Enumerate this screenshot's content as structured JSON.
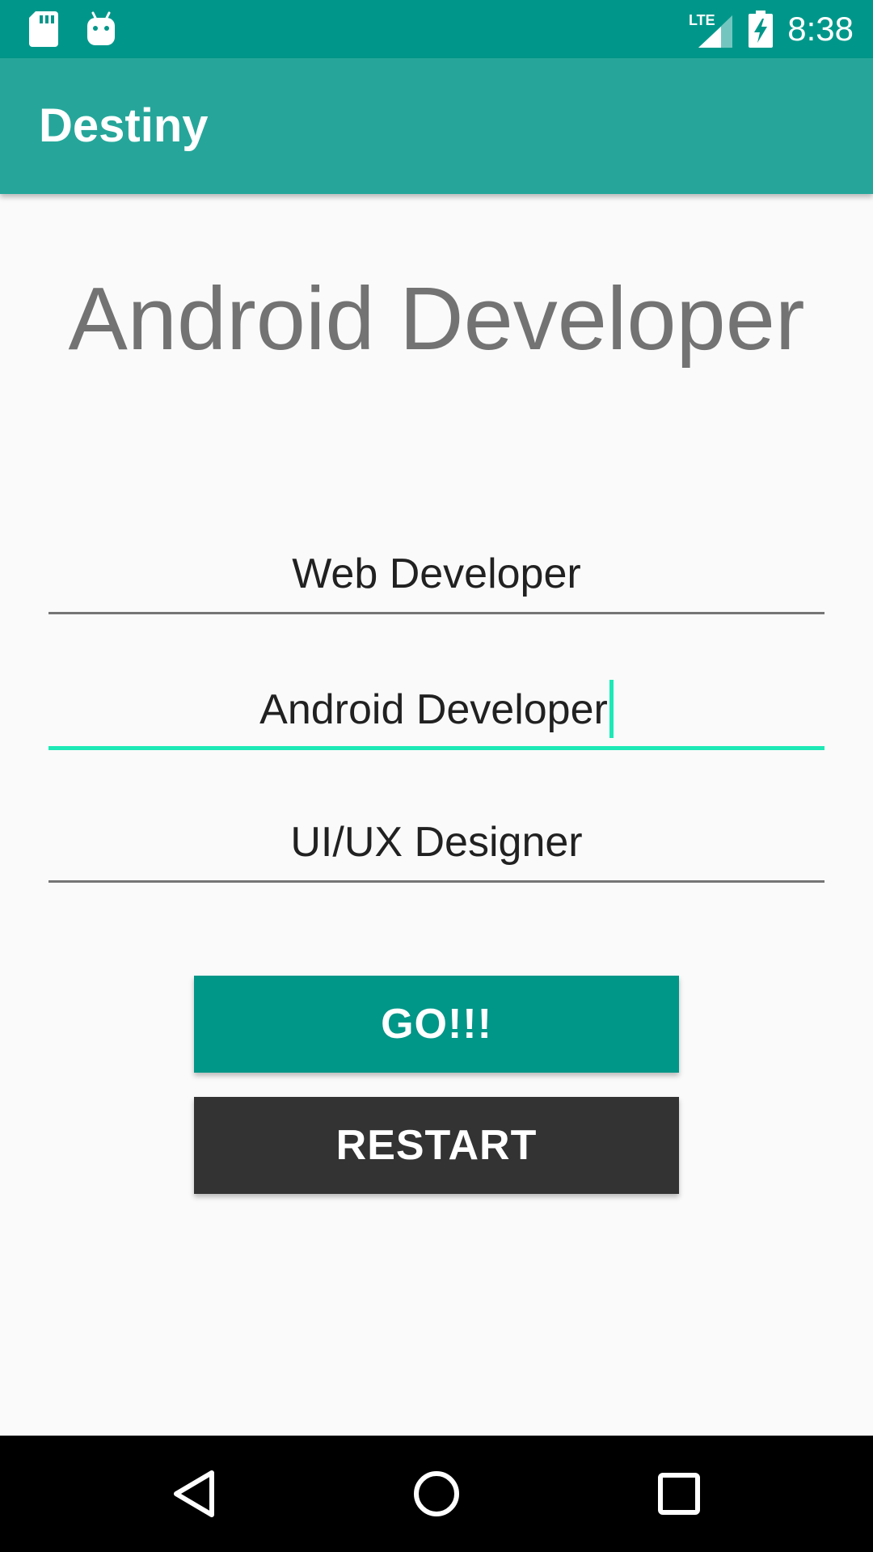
{
  "status_bar": {
    "time": "8:38",
    "network_label": "LTE",
    "left_icons": [
      "sd-card-icon",
      "android-icon"
    ],
    "right_icons": [
      "lte-signal-icon",
      "battery-charging-icon"
    ]
  },
  "app_bar": {
    "title": "Destiny"
  },
  "main": {
    "headline": "Android Developer",
    "fields": [
      {
        "value": "Web Developer",
        "focused": false
      },
      {
        "value": "Android Developer",
        "focused": true
      },
      {
        "value": "UI/UX Designer",
        "focused": false
      }
    ],
    "buttons": {
      "go_label": "GO!!!",
      "restart_label": "RESTART"
    }
  },
  "nav_bar": {
    "icons": [
      "back-icon",
      "home-icon",
      "recents-icon"
    ]
  },
  "colors": {
    "status_bar": "#00978a",
    "app_bar": "#26a69a",
    "accent": "#1de9b6",
    "go_button": "#009688",
    "restart_button": "#333333",
    "headline_text": "#737373"
  }
}
